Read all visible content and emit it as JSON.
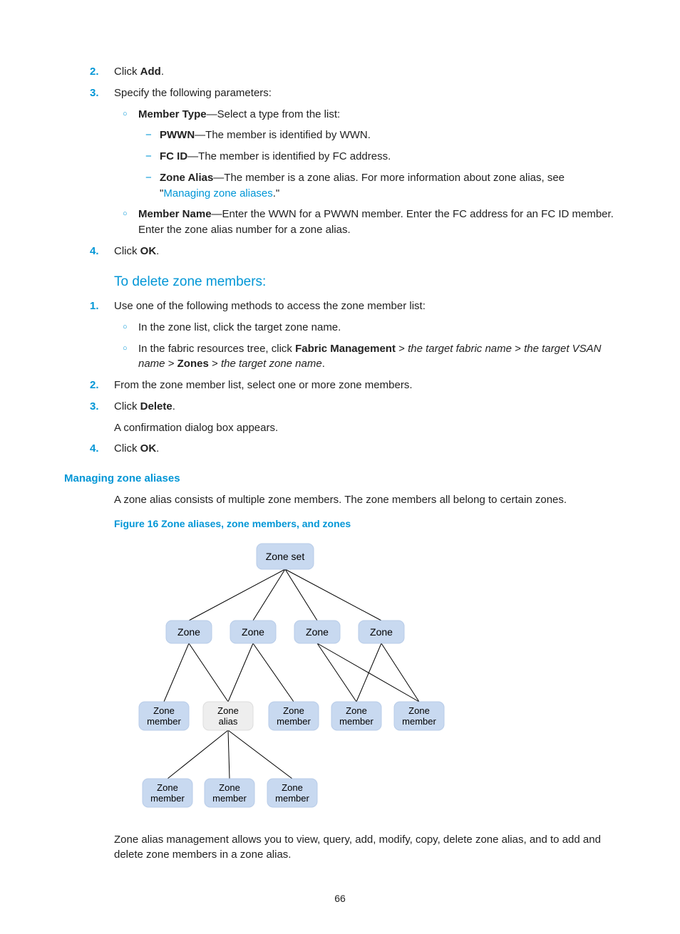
{
  "steps1": {
    "n2": "2.",
    "t2a": "Click ",
    "t2b": "Add",
    "t2c": ".",
    "n3": "3.",
    "t3": "Specify the following parameters:",
    "mt1a": "Member Type",
    "mt1b": "—Select a type from the list:",
    "d1a": "PWWN",
    "d1b": "—The member is identified by WWN.",
    "d2a": "FC ID",
    "d2b": "—The member is identified by FC address.",
    "d3a": "Zone Alias",
    "d3b": "—The member is a zone alias. For more information about zone alias, see \"",
    "d3link": "Managing zone aliases",
    "d3c": ".\"",
    "mn1a": "Member Name",
    "mn1b": "—Enter the WWN for a PWWN member. Enter the FC address for an FC ID member. Enter the zone alias number for a zone alias.",
    "n4": "4.",
    "t4a": "Click ",
    "t4b": "OK",
    "t4c": "."
  },
  "h_delete": "To delete zone members:",
  "steps2": {
    "n1": "1.",
    "t1": "Use one of the following methods to access the zone member list:",
    "c1": "In the zone list, click the target zone name.",
    "c2a": "In the fabric resources tree, click ",
    "c2b": "Fabric Management",
    "c2c": " > ",
    "c2d": "the target fabric name",
    "c2e": " > ",
    "c2f": "the target VSAN name",
    "c2g": " > ",
    "c2h": "Zones",
    "c2i": " > ",
    "c2j": "the target zone name",
    "c2k": ".",
    "n2": "2.",
    "t2": "From the zone member list, select one or more zone members.",
    "n3": "3.",
    "t3a": "Click ",
    "t3b": "Delete",
    "t3c": ".",
    "t3d": "A confirmation dialog box appears.",
    "n4": "4.",
    "t4a": "Click ",
    "t4b": "OK",
    "t4c": "."
  },
  "h_manage": "Managing zone aliases",
  "p_manage": "A zone alias consists of multiple zone members. The zone members all belong to certain zones.",
  "figcap": "Figure 16 Zone aliases, zone members, and zones",
  "diagram": {
    "zoneset": "Zone set",
    "zone": "Zone",
    "zonemember": "Zone\nmember",
    "zonealias": "Zone\nalias"
  },
  "p_footer": "Zone alias management allows you to view, query, add, modify, copy, delete zone alias, and to add and delete zone members in a zone alias.",
  "pagenum": "66"
}
